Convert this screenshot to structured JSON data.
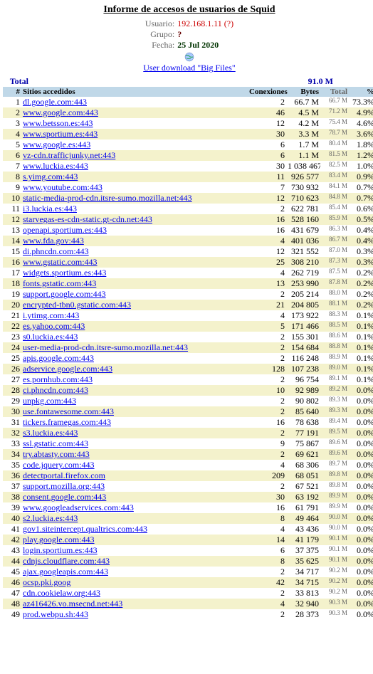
{
  "title": "Informe de accesos de usuarios de Squid",
  "meta": {
    "user_label": "Usuario:",
    "user_value": "192.168.1.11 (?)",
    "group_label": "Grupo:",
    "group_value": "?",
    "date_label": "Fecha:",
    "date_value": "25 Jul 2020"
  },
  "download_link": "User download \"Big Files\"",
  "totals": {
    "label": "Total",
    "bytes": "91.0 M"
  },
  "headers": {
    "idx": "#",
    "site": "Sitios accedidos",
    "conn": "Conexiones",
    "bytes": "Bytes",
    "total": "Total",
    "pct": "%"
  },
  "rows": [
    {
      "i": 1,
      "site": "dl.google.com:443",
      "conn": "2",
      "bytes": "66.7 M",
      "total": "66.7 M",
      "pct": "73.3%"
    },
    {
      "i": 2,
      "site": "www.google.com:443",
      "conn": "46",
      "bytes": "4.5 M",
      "total": "71.2 M",
      "pct": "4.9%"
    },
    {
      "i": 3,
      "site": "www.betsson.es:443",
      "conn": "12",
      "bytes": "4.2 M",
      "total": "75.4 M",
      "pct": "4.6%"
    },
    {
      "i": 4,
      "site": "www.sportium.es:443",
      "conn": "30",
      "bytes": "3.3 M",
      "total": "78.7 M",
      "pct": "3.6%"
    },
    {
      "i": 5,
      "site": "www.google.es:443",
      "conn": "6",
      "bytes": "1.7 M",
      "total": "80.4 M",
      "pct": "1.8%"
    },
    {
      "i": 6,
      "site": "vz-cdn.trafficjunky.net:443",
      "conn": "6",
      "bytes": "1.1 M",
      "total": "81.5 M",
      "pct": "1.2%"
    },
    {
      "i": 7,
      "site": "www.luckia.es:443",
      "conn": "30",
      "bytes": "1 038 467",
      "total": "82.5 M",
      "pct": "1.0%"
    },
    {
      "i": 8,
      "site": "s.yimg.com:443",
      "conn": "11",
      "bytes": "926 577",
      "total": "83.4 M",
      "pct": "0.9%"
    },
    {
      "i": 9,
      "site": "www.youtube.com:443",
      "conn": "7",
      "bytes": "730 932",
      "total": "84.1 M",
      "pct": "0.7%"
    },
    {
      "i": 10,
      "site": "static-media-prod-cdn.itsre-sumo.mozilla.net:443",
      "conn": "12",
      "bytes": "710 623",
      "total": "84.8 M",
      "pct": "0.7%"
    },
    {
      "i": 11,
      "site": "i3.luckia.es:443",
      "conn": "2",
      "bytes": "622 781",
      "total": "85.4 M",
      "pct": "0.6%"
    },
    {
      "i": 12,
      "site": "starvegas-es-cdn-static.gt-cdn.net:443",
      "conn": "16",
      "bytes": "528 160",
      "total": "85.9 M",
      "pct": "0.5%"
    },
    {
      "i": 13,
      "site": "openapi.sportium.es:443",
      "conn": "16",
      "bytes": "431 679",
      "total": "86.3 M",
      "pct": "0.4%"
    },
    {
      "i": 14,
      "site": "www.fda.gov:443",
      "conn": "4",
      "bytes": "401 036",
      "total": "86.7 M",
      "pct": "0.4%"
    },
    {
      "i": 15,
      "site": "di.phncdn.com:443",
      "conn": "12",
      "bytes": "321 552",
      "total": "87.0 M",
      "pct": "0.3%"
    },
    {
      "i": 16,
      "site": "www.gstatic.com:443",
      "conn": "25",
      "bytes": "308 210",
      "total": "87.3 M",
      "pct": "0.3%"
    },
    {
      "i": 17,
      "site": "widgets.sportium.es:443",
      "conn": "4",
      "bytes": "262 719",
      "total": "87.5 M",
      "pct": "0.2%"
    },
    {
      "i": 18,
      "site": "fonts.gstatic.com:443",
      "conn": "13",
      "bytes": "253 990",
      "total": "87.8 M",
      "pct": "0.2%"
    },
    {
      "i": 19,
      "site": "support.google.com:443",
      "conn": "2",
      "bytes": "205 214",
      "total": "88.0 M",
      "pct": "0.2%"
    },
    {
      "i": 20,
      "site": "encrypted-tbn0.gstatic.com:443",
      "conn": "21",
      "bytes": "204 805",
      "total": "88.1 M",
      "pct": "0.2%"
    },
    {
      "i": 21,
      "site": "i.ytimg.com:443",
      "conn": "4",
      "bytes": "173 922",
      "total": "88.3 M",
      "pct": "0.1%"
    },
    {
      "i": 22,
      "site": "es.yahoo.com:443",
      "conn": "5",
      "bytes": "171 466",
      "total": "88.5 M",
      "pct": "0.1%"
    },
    {
      "i": 23,
      "site": "s0.luckia.es:443",
      "conn": "2",
      "bytes": "155 301",
      "total": "88.6 M",
      "pct": "0.1%"
    },
    {
      "i": 24,
      "site": "user-media-prod-cdn.itsre-sumo.mozilla.net:443",
      "conn": "2",
      "bytes": "154 684",
      "total": "88.8 M",
      "pct": "0.1%"
    },
    {
      "i": 25,
      "site": "apis.google.com:443",
      "conn": "2",
      "bytes": "116 248",
      "total": "88.9 M",
      "pct": "0.1%"
    },
    {
      "i": 26,
      "site": "adservice.google.com:443",
      "conn": "128",
      "bytes": "107 238",
      "total": "89.0 M",
      "pct": "0.1%"
    },
    {
      "i": 27,
      "site": "es.pornhub.com:443",
      "conn": "2",
      "bytes": "96 754",
      "total": "89.1 M",
      "pct": "0.1%"
    },
    {
      "i": 28,
      "site": "ci.phncdn.com:443",
      "conn": "10",
      "bytes": "92 989",
      "total": "89.2 M",
      "pct": "0.0%"
    },
    {
      "i": 29,
      "site": "unpkg.com:443",
      "conn": "2",
      "bytes": "90 802",
      "total": "89.3 M",
      "pct": "0.0%"
    },
    {
      "i": 30,
      "site": "use.fontawesome.com:443",
      "conn": "2",
      "bytes": "85 640",
      "total": "89.3 M",
      "pct": "0.0%"
    },
    {
      "i": 31,
      "site": "tickers.framegas.com:443",
      "conn": "16",
      "bytes": "78 638",
      "total": "89.4 M",
      "pct": "0.0%"
    },
    {
      "i": 32,
      "site": "s3.luckia.es:443",
      "conn": "2",
      "bytes": "77 191",
      "total": "89.5 M",
      "pct": "0.0%"
    },
    {
      "i": 33,
      "site": "ssl.gstatic.com:443",
      "conn": "9",
      "bytes": "75 867",
      "total": "89.6 M",
      "pct": "0.0%"
    },
    {
      "i": 34,
      "site": "try.abtasty.com:443",
      "conn": "2",
      "bytes": "69 621",
      "total": "89.6 M",
      "pct": "0.0%"
    },
    {
      "i": 35,
      "site": "code.jquery.com:443",
      "conn": "4",
      "bytes": "68 306",
      "total": "89.7 M",
      "pct": "0.0%"
    },
    {
      "i": 36,
      "site": "detectportal.firefox.com",
      "conn": "209",
      "bytes": "68 051",
      "total": "89.8 M",
      "pct": "0.0%"
    },
    {
      "i": 37,
      "site": "support.mozilla.org:443",
      "conn": "2",
      "bytes": "67 521",
      "total": "89.8 M",
      "pct": "0.0%"
    },
    {
      "i": 38,
      "site": "consent.google.com:443",
      "conn": "30",
      "bytes": "63 192",
      "total": "89.9 M",
      "pct": "0.0%"
    },
    {
      "i": 39,
      "site": "www.googleadservices.com:443",
      "conn": "16",
      "bytes": "61 791",
      "total": "89.9 M",
      "pct": "0.0%"
    },
    {
      "i": 40,
      "site": "s2.luckia.es:443",
      "conn": "8",
      "bytes": "49 464",
      "total": "90.0 M",
      "pct": "0.0%"
    },
    {
      "i": 41,
      "site": "gov1.siteintercept.qualtrics.com:443",
      "conn": "4",
      "bytes": "43 436",
      "total": "90.0 M",
      "pct": "0.0%"
    },
    {
      "i": 42,
      "site": "play.google.com:443",
      "conn": "14",
      "bytes": "41 179",
      "total": "90.1 M",
      "pct": "0.0%"
    },
    {
      "i": 43,
      "site": "login.sportium.es:443",
      "conn": "6",
      "bytes": "37 375",
      "total": "90.1 M",
      "pct": "0.0%"
    },
    {
      "i": 44,
      "site": "cdnjs.cloudflare.com:443",
      "conn": "8",
      "bytes": "35 625",
      "total": "90.1 M",
      "pct": "0.0%"
    },
    {
      "i": 45,
      "site": "ajax.googleapis.com:443",
      "conn": "2",
      "bytes": "34 717",
      "total": "90.2 M",
      "pct": "0.0%"
    },
    {
      "i": 46,
      "site": "ocsp.pki.goog",
      "conn": "42",
      "bytes": "34 715",
      "total": "90.2 M",
      "pct": "0.0%"
    },
    {
      "i": 47,
      "site": "cdn.cookielaw.org:443",
      "conn": "2",
      "bytes": "33 813",
      "total": "90.2 M",
      "pct": "0.0%"
    },
    {
      "i": 48,
      "site": "az416426.vo.msecnd.net:443",
      "conn": "4",
      "bytes": "32 940",
      "total": "90.3 M",
      "pct": "0.0%"
    },
    {
      "i": 49,
      "site": "prod.webpu.sh:443",
      "conn": "2",
      "bytes": "28 373",
      "total": "90.3 M",
      "pct": "0.0%"
    }
  ]
}
